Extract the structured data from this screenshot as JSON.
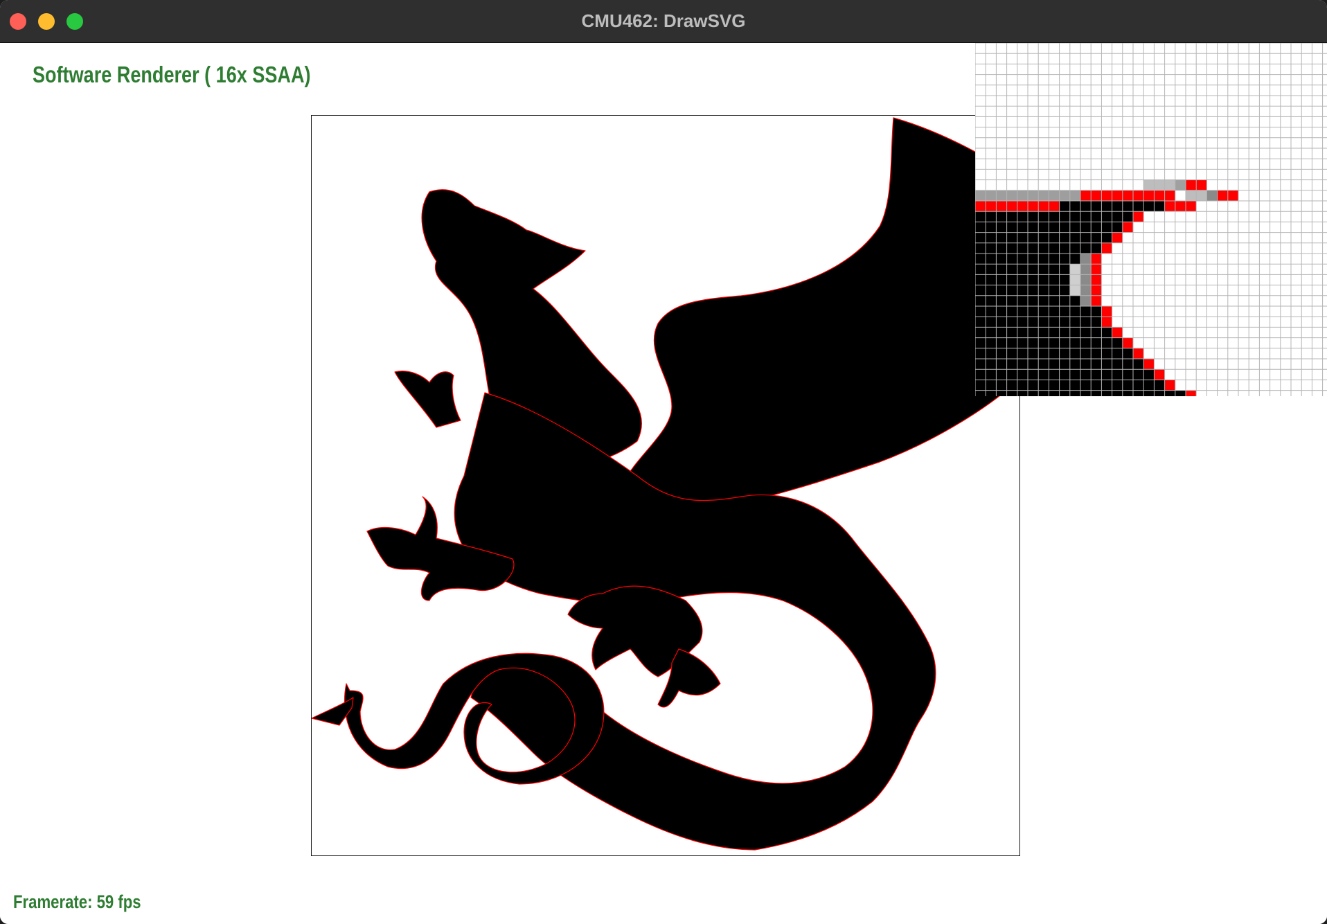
{
  "window": {
    "title": "CMU462: DrawSVG"
  },
  "renderer": {
    "label": "Software Renderer ( 16x SSAA)"
  },
  "status": {
    "framerate": "Framerate: 59 fps"
  },
  "colors": {
    "label_green": "#2e7d32",
    "shape_fill": "#000000",
    "outline": "#ff0000",
    "grid_line": "#b5b5b5"
  },
  "icons": {
    "close": "close-dot-icon",
    "minimize": "minimize-dot-icon",
    "maximize": "maximize-dot-icon"
  }
}
